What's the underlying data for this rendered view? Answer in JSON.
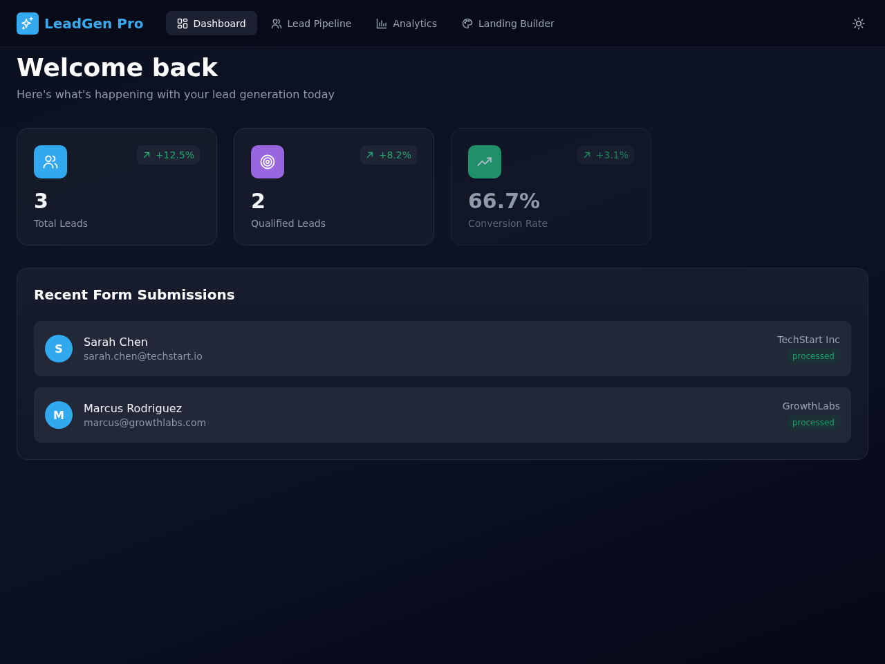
{
  "brand": {
    "name": "LeadGen Pro"
  },
  "nav": [
    {
      "label": "Dashboard",
      "selected": true
    },
    {
      "label": "Lead Pipeline",
      "selected": false
    },
    {
      "label": "Analytics",
      "selected": false
    },
    {
      "label": "Landing Builder",
      "selected": false
    }
  ],
  "header": {
    "title": "Welcome back",
    "subtitle": "Here's what's happening with your lead generation today"
  },
  "stats": [
    {
      "value": "3",
      "label": "Total Leads",
      "change": "+12.5%",
      "color": "#32a9ef",
      "dimmed": false
    },
    {
      "value": "2",
      "label": "Qualified Leads",
      "change": "+8.2%",
      "color": "#9966e0",
      "dimmed": false
    },
    {
      "value": "66.7%",
      "label": "Conversion Rate",
      "change": "+3.1%",
      "color": "#20906a",
      "dimmed": true
    }
  ],
  "submissions": {
    "title": "Recent Form Submissions",
    "rows": [
      {
        "initial": "S",
        "name": "Sarah Chen",
        "email": "sarah.chen@techstart.io",
        "company": "TechStart Inc",
        "status": "processed"
      },
      {
        "initial": "M",
        "name": "Marcus Rodriguez",
        "email": "marcus@growthlabs.com",
        "company": "GrowthLabs",
        "status": "processed"
      }
    ]
  }
}
